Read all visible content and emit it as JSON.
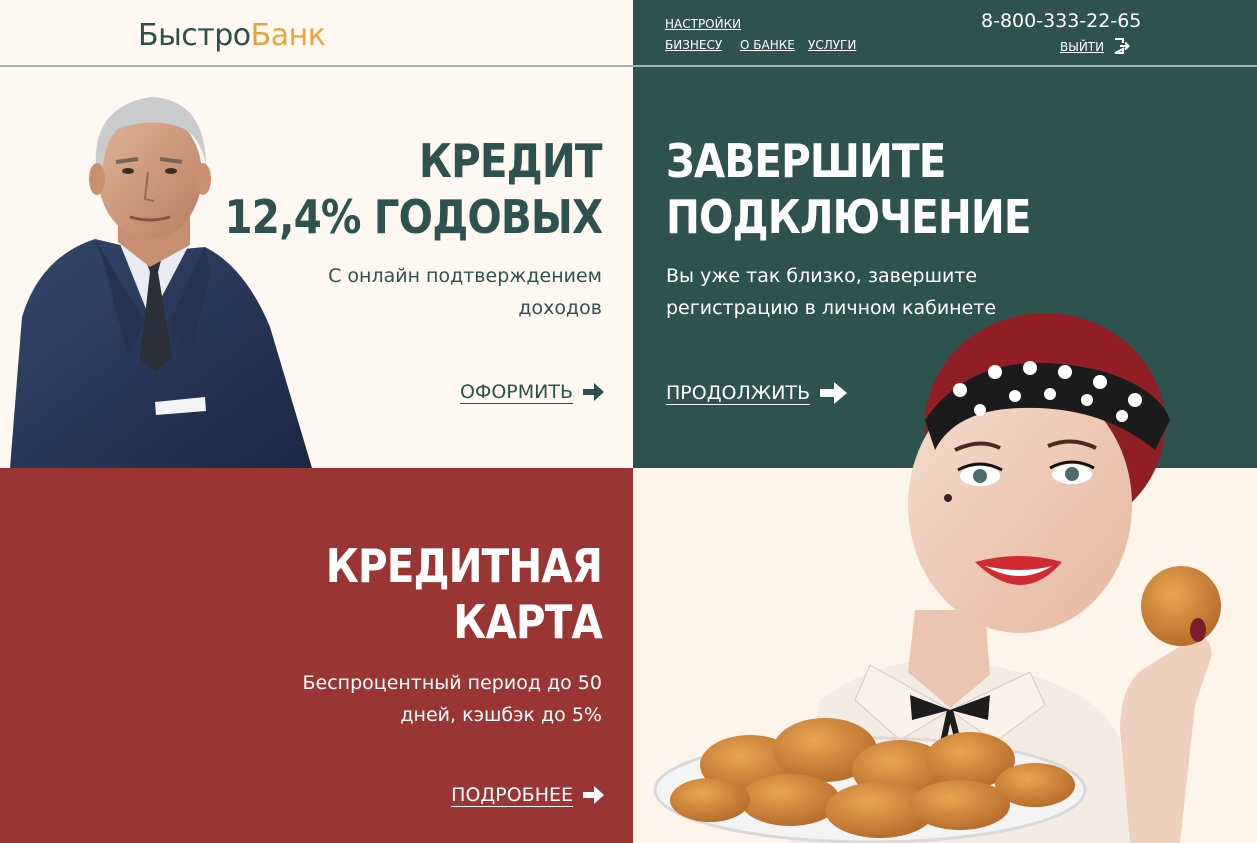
{
  "brand": {
    "part1": "Быстро",
    "part2": "Банк"
  },
  "header": {
    "settings": "НАСТРОЙКИ",
    "nav": [
      "БИЗНЕСУ",
      "О БАНКЕ",
      "УСЛУГИ"
    ],
    "phone": "8-800-333-22-65",
    "logout": "ВЫЙТИ"
  },
  "tiles": {
    "credit": {
      "title_line1": "КРЕДИТ",
      "title_line2": "12,4% ГОДОВЫХ",
      "sub_line1": "С онлайн подтверждением",
      "sub_line2": "доходов",
      "cta": "ОФОРМИТЬ"
    },
    "connect": {
      "title_line1": "ЗАВЕРШИТЕ",
      "title_line2": "ПОДКЛЮЧЕНИЕ",
      "sub_line1": "Вы уже так близко, завершите",
      "sub_line2": "регистрацию в личном кабинете",
      "cta": "ПРОДОЛЖИТЬ"
    },
    "card": {
      "title_line1": "КРЕДИТНАЯ",
      "title_line2": "КАРТА",
      "sub_line1": "Беспроцентный период до 50",
      "sub_line2": "дней, кэшбэк до 5%",
      "cta": "ПОДРОБНЕЕ"
    }
  },
  "colors": {
    "dark_green": "#2e534f",
    "cream": "#fdf8f1",
    "red": "#993532",
    "accent_orange": "#e7a43d"
  },
  "icons": [
    "logout-icon",
    "arrow-right-icon"
  ]
}
